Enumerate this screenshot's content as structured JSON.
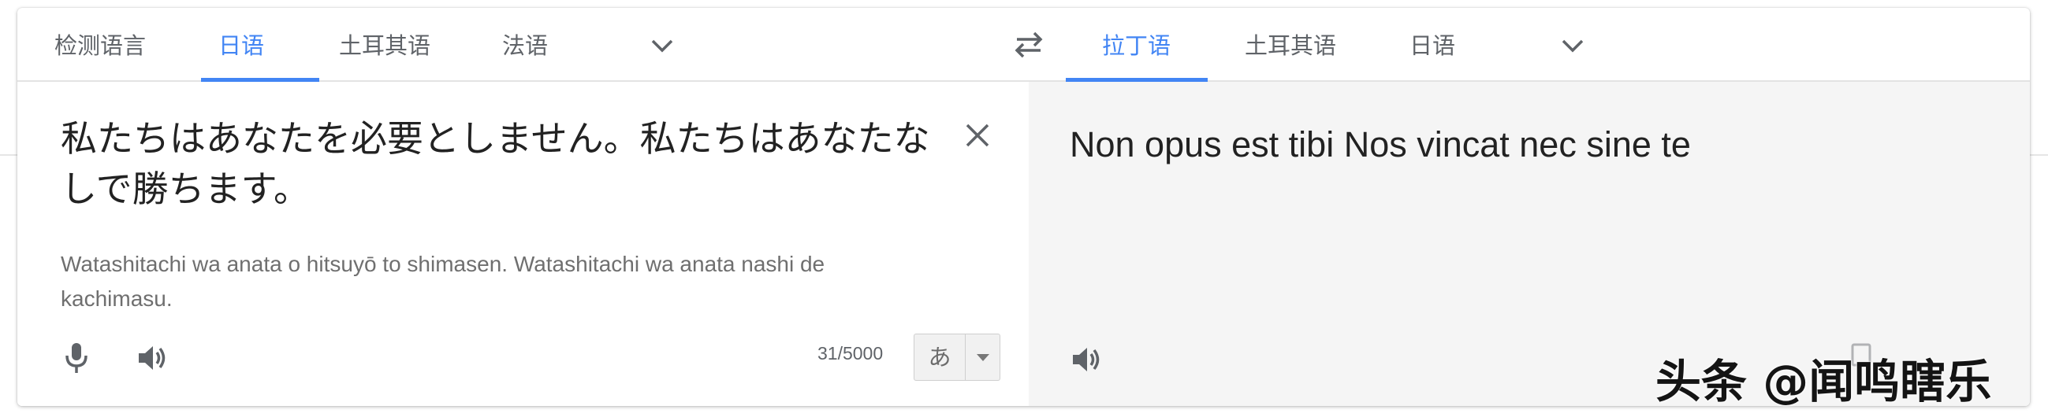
{
  "source_langs": {
    "tabs": [
      {
        "label": "检测语言"
      },
      {
        "label": "日语"
      },
      {
        "label": "土耳其语"
      },
      {
        "label": "法语"
      }
    ],
    "active_index": 1,
    "more_icon": "chevron-down-icon"
  },
  "swap_icon": "swap-arrows-icon",
  "target_langs": {
    "tabs": [
      {
        "label": "拉丁语"
      },
      {
        "label": "土耳其语"
      },
      {
        "label": "日语"
      }
    ],
    "active_index": 0,
    "more_icon": "chevron-down-icon"
  },
  "source": {
    "text": "私たちはあなたを必要としません。私たちはあなたなしで勝ちます。",
    "romanization": "Watashitachi wa anata o hitsuyō to shimasen. Watashitachi wa anata nashi de kachimasu.",
    "char_count": "31/5000",
    "ime_label": "あ",
    "clear_icon": "close-icon",
    "mic_icon": "microphone-icon",
    "speaker_icon": "speaker-icon"
  },
  "target": {
    "text": "Non opus est tibi Nos vincat nec sine te",
    "speaker_icon": "speaker-icon"
  },
  "watermark": "头条 @闻鸣瞎乐",
  "colors": {
    "accent": "#4285f4",
    "tab_text": "#5f6368",
    "target_bg": "#f5f5f5"
  }
}
